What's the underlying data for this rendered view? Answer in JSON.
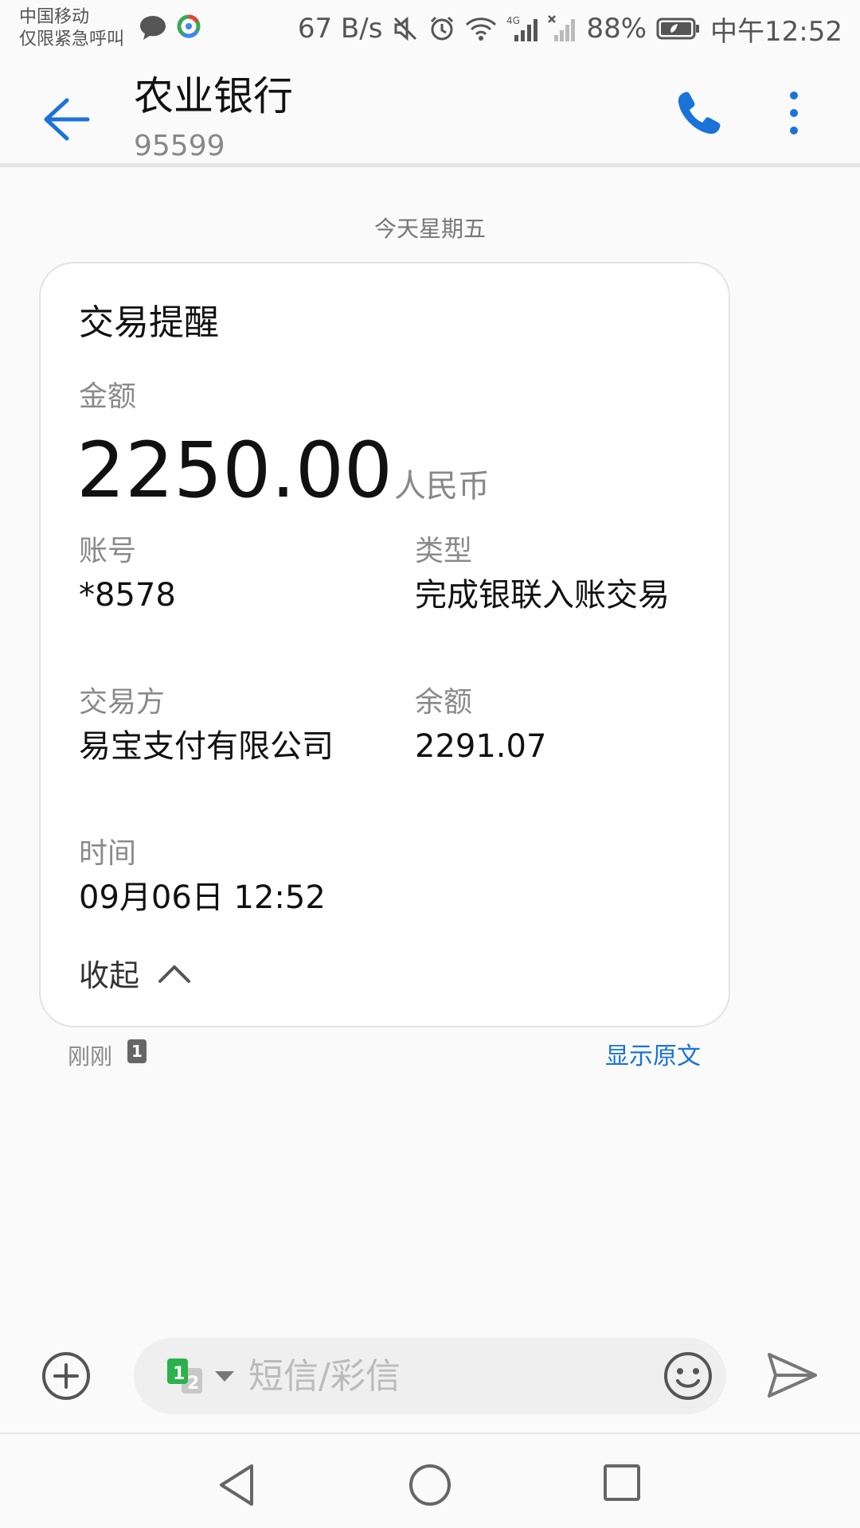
{
  "status_bar": {
    "carrier": "中国移动",
    "carrier_note": "仅限紧急呼叫",
    "net_speed": "67 B/s",
    "battery": "88%",
    "time": "中午12:52",
    "icons": [
      "chat-icon",
      "browser-icon",
      "mute-icon",
      "alarm-icon",
      "wifi-icon",
      "signal-4g-icon",
      "signal-none-icon",
      "battery-icon"
    ]
  },
  "header": {
    "contact_name": "农业银行",
    "contact_number": "95599"
  },
  "conversation": {
    "date_divider": "今天星期五"
  },
  "card": {
    "title": "交易提醒",
    "amount_label": "金额",
    "amount": "2250.00",
    "currency": "人民币",
    "account_label": "账号",
    "account": "*8578",
    "type_label": "类型",
    "type": "完成银联入账交易",
    "counterparty_label": "交易方",
    "counterparty": "易宝支付有限公司",
    "balance_label": "余额",
    "balance": "2291.07",
    "time_label": "时间",
    "time": "09月06日 12:52",
    "collapse_label": "收起"
  },
  "message_meta": {
    "sent_time": "刚刚",
    "sim_slot": "1",
    "show_original": "显示原文"
  },
  "compose": {
    "placeholder": "短信/彩信",
    "sim_primary": "1",
    "sim_secondary": "2"
  },
  "colors": {
    "accent": "#1a73d9",
    "sim_green": "#2bb24c",
    "background": "#fafafa"
  }
}
